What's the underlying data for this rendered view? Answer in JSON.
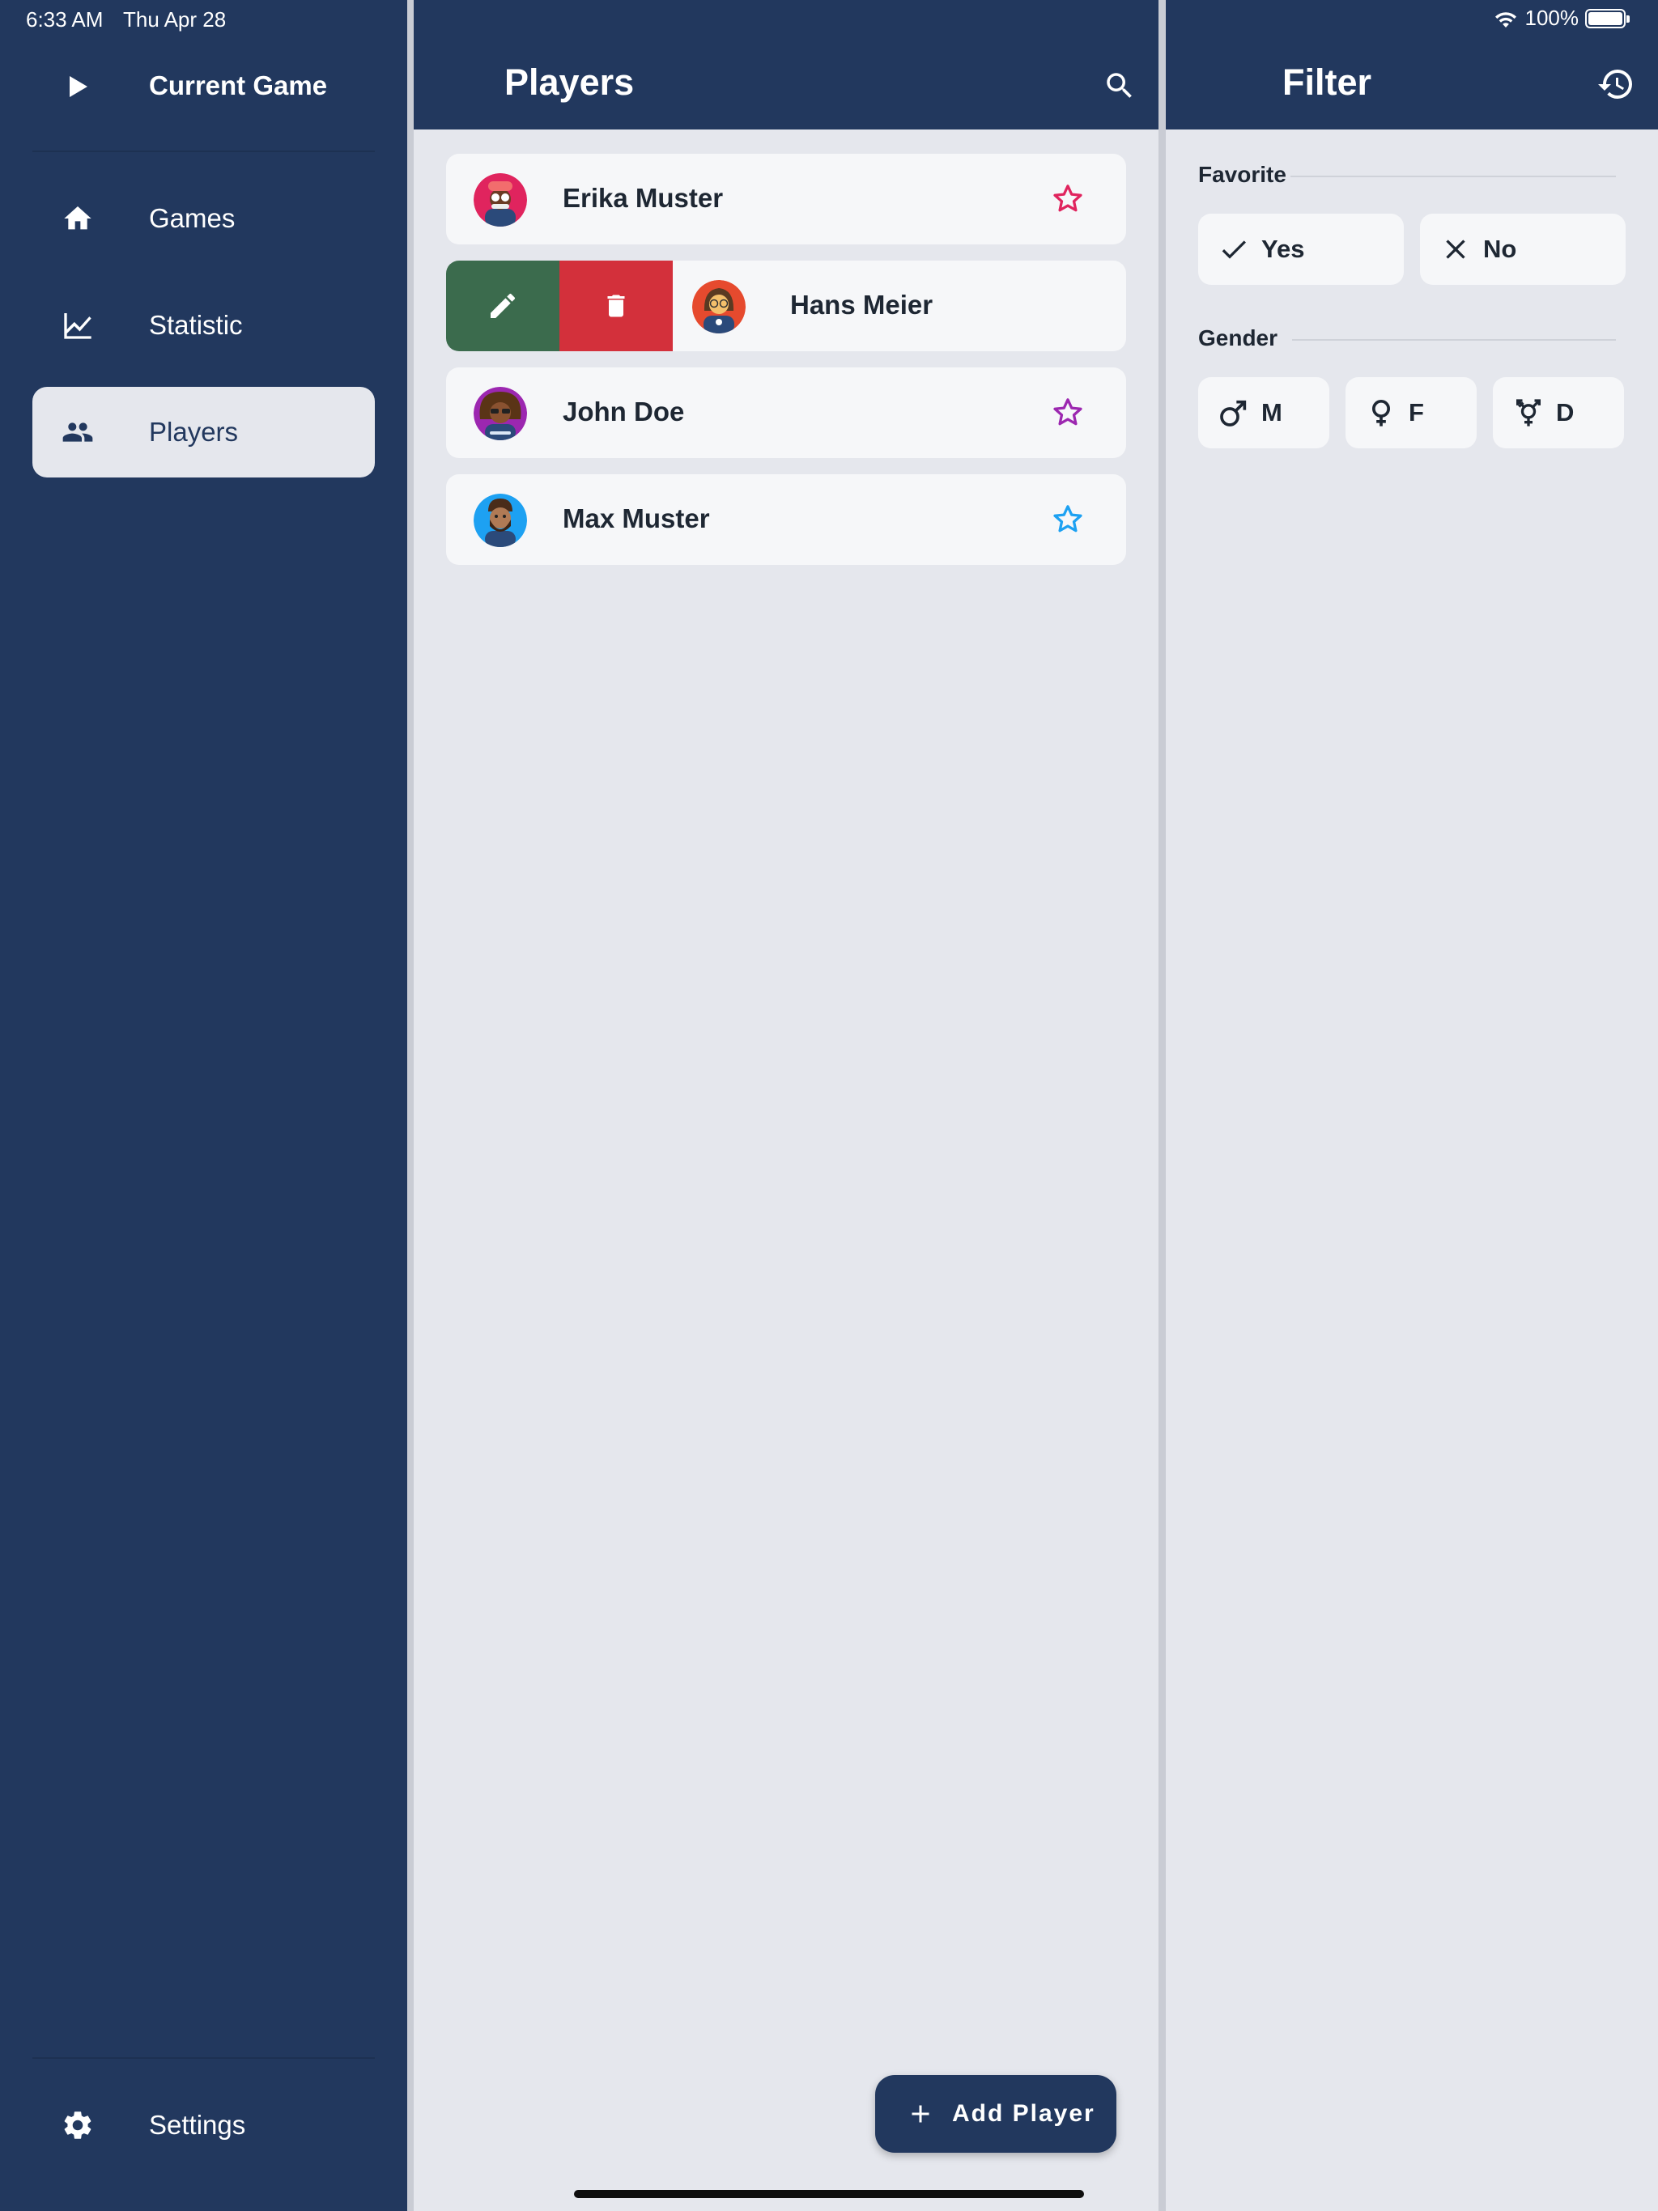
{
  "status_bar": {
    "time": "6:33 AM",
    "date": "Thu Apr 28",
    "battery": "100%"
  },
  "sidebar": {
    "current_game_label": "Current Game",
    "items": [
      {
        "label": "Games",
        "icon": "home-icon"
      },
      {
        "label": "Statistic",
        "icon": "chart-line-icon"
      },
      {
        "label": "Players",
        "icon": "people-icon",
        "active": true
      }
    ],
    "settings_label": "Settings"
  },
  "players": {
    "title": "Players",
    "list": [
      {
        "name": "Erika Muster",
        "star_color": "#e0245e"
      },
      {
        "name": "Hans Meier",
        "swiped": true
      },
      {
        "name": "John Doe",
        "star_color": "#9c27b0"
      },
      {
        "name": "Max Muster",
        "star_color": "#1da1f2"
      }
    ],
    "add_label": "Add Player"
  },
  "filter": {
    "title": "Filter",
    "favorite_label": "Favorite",
    "favorite_yes": "Yes",
    "favorite_no": "No",
    "gender_label": "Gender",
    "gender_m": "M",
    "gender_f": "F",
    "gender_d": "D"
  },
  "colors": {
    "navy": "#22385e",
    "panel_bg": "#e5e7ed",
    "card_bg": "#f6f7f9",
    "edit_green": "#3b6b4d",
    "delete_red": "#d3303b"
  }
}
